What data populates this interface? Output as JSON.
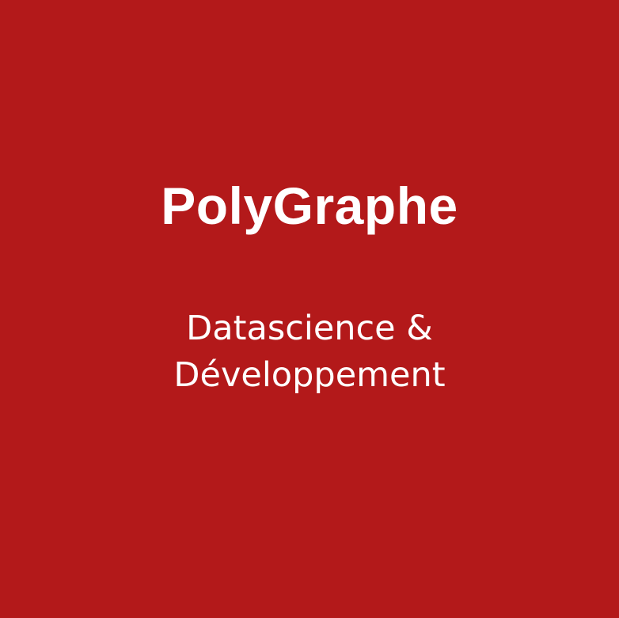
{
  "theme": {
    "background": "#b3191a",
    "text": "#ffffff"
  },
  "logo": {
    "title": "PolyGraphe",
    "tagline_line1": "Datascience &",
    "tagline_line2": "Développement"
  }
}
